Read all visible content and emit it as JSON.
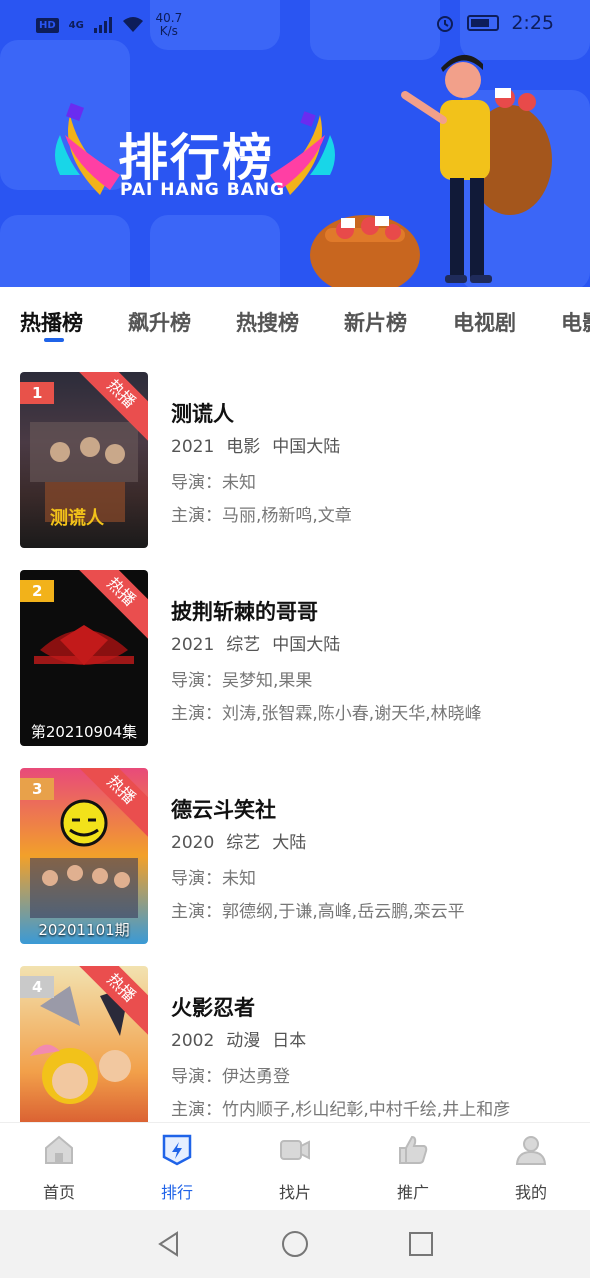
{
  "status_bar": {
    "network_badge": "HD",
    "network_type": "4G",
    "speed_value": "40.7",
    "speed_unit": "K/s",
    "time": "2:25"
  },
  "banner": {
    "title": "排行榜",
    "subtitle": "PAI HANG BANG"
  },
  "tabs": [
    {
      "label": "热播榜",
      "active": true
    },
    {
      "label": "飙升榜",
      "active": false
    },
    {
      "label": "热搜榜",
      "active": false
    },
    {
      "label": "新片榜",
      "active": false
    },
    {
      "label": "电视剧",
      "active": false
    },
    {
      "label": "电影",
      "active": false
    }
  ],
  "ribbon_label": "热播",
  "items": [
    {
      "rank": "1",
      "title": "测谎人",
      "year": "2021",
      "category": "电影",
      "region": "中国大陆",
      "director": "导演：未知",
      "cast": "主演：马丽,杨新鸣,文章",
      "poster_caption": "",
      "rank_color": "#e8524a"
    },
    {
      "rank": "2",
      "title": "披荆斩棘的哥哥",
      "year": "2021",
      "category": "综艺",
      "region": "中国大陆",
      "director": "导演：吴梦知,果果",
      "cast": "主演：刘涛,张智霖,陈小春,谢天华,林晓峰",
      "poster_caption": "第20210904集",
      "rank_color": "#f2b21a"
    },
    {
      "rank": "3",
      "title": "德云斗笑社",
      "year": "2020",
      "category": "综艺",
      "region": "大陆",
      "director": "导演：未知",
      "cast": "主演：郭德纲,于谦,高峰,岳云鹏,栾云平",
      "poster_caption": "20201101期",
      "rank_color": "#e8a14a"
    },
    {
      "rank": "4",
      "title": "火影忍者",
      "year": "2002",
      "category": "动漫",
      "region": "日本",
      "director": "导演：伊达勇登",
      "cast": "主演：竹内顺子,杉山纪彰,中村千绘,井上和彦",
      "poster_caption": "",
      "rank_color": "#c9c9c9"
    }
  ],
  "bottom_nav": [
    {
      "label": "首页",
      "icon": "home-icon",
      "active": false
    },
    {
      "label": "排行",
      "icon": "ranking-icon",
      "active": true
    },
    {
      "label": "找片",
      "icon": "video-icon",
      "active": false
    },
    {
      "label": "推广",
      "icon": "thumbs-up-icon",
      "active": false
    },
    {
      "label": "我的",
      "icon": "user-icon",
      "active": false
    }
  ],
  "colors": {
    "banner_blue": "#2a55f2",
    "accent_blue": "#1f63e8",
    "ribbon_red": "#ea4e4e"
  }
}
